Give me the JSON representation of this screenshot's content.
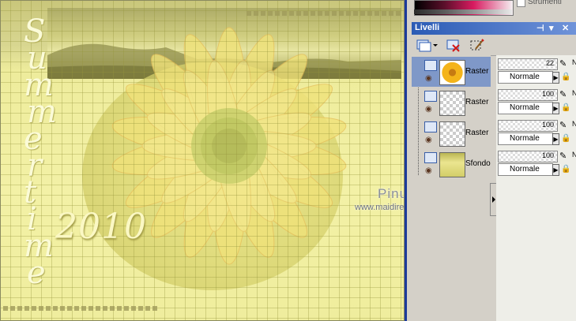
{
  "canvas": {
    "vertical_title": [
      "S",
      "u",
      "m",
      "m",
      "e",
      "r",
      "t",
      "i",
      "m",
      "e"
    ],
    "year": "2010",
    "watermark_name": "Pinuccia",
    "watermark_url": "www.maidiregrafica.eu"
  },
  "top_palette": {
    "checkbox_label": "Strumenti"
  },
  "layers_panel": {
    "title": "Livelli",
    "title_controls": [
      "⊣",
      "▾",
      "✕"
    ],
    "toolbar": {
      "new_layer_icon": "new-raster-layer-icon",
      "delete_icon": "delete-layer-icon",
      "mask_icon": "edit-selection-icon"
    },
    "layers": [
      {
        "name": "Raster",
        "opacity": "22",
        "blend": "Normale",
        "selected": true,
        "thumb": "flower"
      },
      {
        "name": "Raster",
        "opacity": "100",
        "blend": "Normale",
        "selected": false,
        "thumb": "checker"
      },
      {
        "name": "Raster",
        "opacity": "100",
        "blend": "Normale",
        "selected": false,
        "thumb": "checker"
      },
      {
        "name": "Sfondo",
        "opacity": "100",
        "blend": "Normale",
        "selected": false,
        "thumb": "yellow"
      }
    ],
    "extra_letter": "N"
  },
  "colors": {
    "title_bar": "#2b5bb5",
    "selected_row": "#7f98c8",
    "canvas_yellow": "#f3f1a6"
  }
}
